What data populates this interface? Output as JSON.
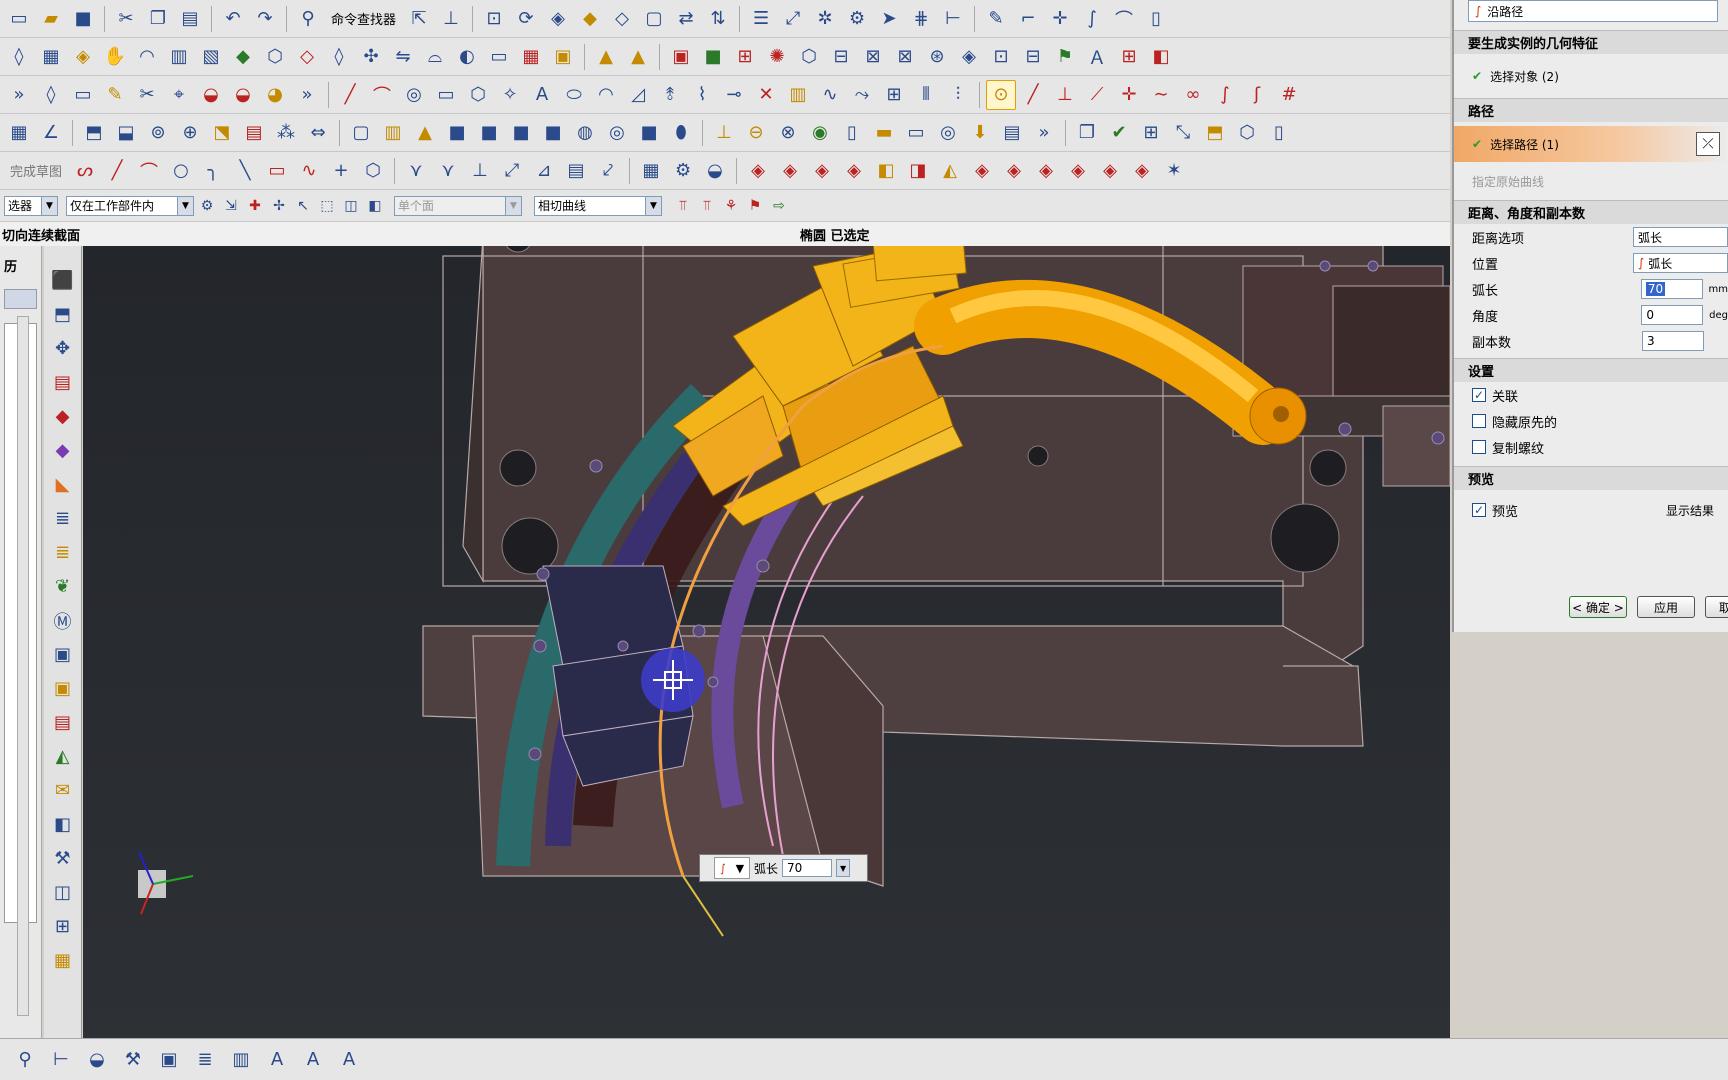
{
  "toolbar": {
    "command_finder": "命令查找器",
    "finish_sketch": "完成草图",
    "filter_label": "选器",
    "scope_select": "仅在工作部件内",
    "face_select": "单个面",
    "curve_rule_select": "相切曲线"
  },
  "header": {
    "dialog_name": "切向连续截面",
    "selection_status": "椭圆 已选定"
  },
  "left_dock": {
    "history_label": "历"
  },
  "viewport": {
    "tooltip_label": "弧长",
    "tooltip_value": "70"
  },
  "panel": {
    "top_option": "沿路径",
    "section_geom": "要生成实例的几何特征",
    "select_object": "选择对象 (2)",
    "section_path": "路径",
    "select_path": "选择路径 (1)",
    "specify_curve": "指定原始曲线",
    "section_dist": "距离、角度和副本数",
    "distance_option_label": "距离选项",
    "distance_option_value": "弧长",
    "position_label": "位置",
    "position_value": "弧长",
    "arc_length_label": "弧长",
    "arc_length_value": "70",
    "arc_length_unit": "mm",
    "angle_label": "角度",
    "angle_value": "0",
    "angle_unit": "deg",
    "copies_label": "副本数",
    "copies_value": "3",
    "section_settings": "设置",
    "associative": "关联",
    "hide_original": "隐藏原先的",
    "copy_threads": "复制螺纹",
    "section_preview": "预览",
    "preview": "预览",
    "show_result": "显示结果",
    "ok": "< 确定 >",
    "apply": "应用",
    "cancel": "取"
  },
  "colors": {
    "viewport_bg": "#26292e",
    "mold_base": "#5a4848",
    "gold_part": "#f2b418",
    "path_curve": "#f0a040",
    "highlight": "#3c3cc8",
    "active_row": "#f0a866"
  }
}
